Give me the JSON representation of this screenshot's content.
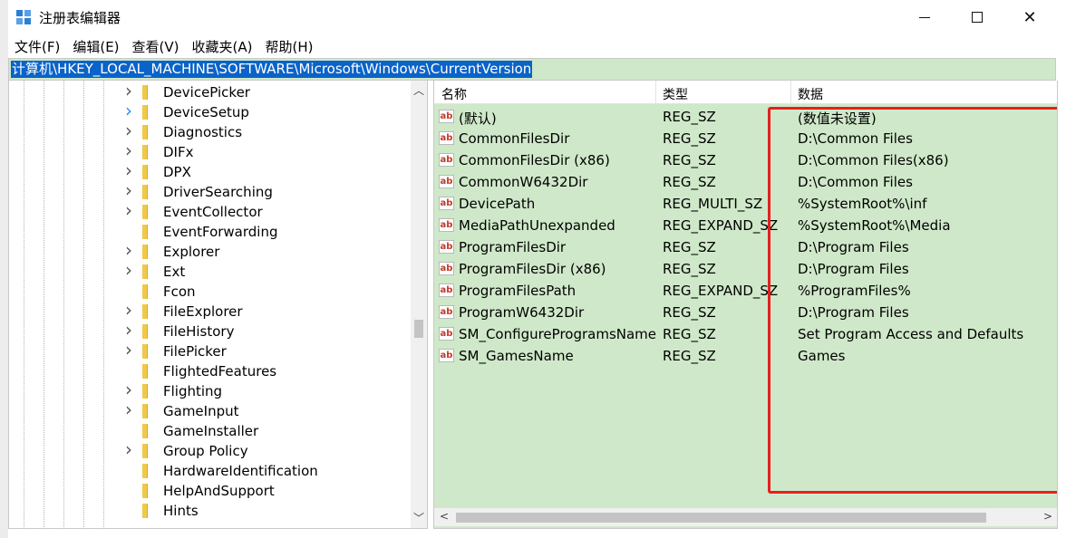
{
  "window": {
    "title": "注册表编辑器",
    "minimize_icon": "minimize-icon",
    "maximize_icon": "maximize-icon",
    "close_glyph": "✕"
  },
  "menu": [
    "文件(F)",
    "编辑(E)",
    "查看(V)",
    "收藏夹(A)",
    "帮助(H)"
  ],
  "address": {
    "path": "计算机\\HKEY_LOCAL_MACHINE\\SOFTWARE\\Microsoft\\Windows\\CurrentVersion"
  },
  "tree": {
    "items": [
      {
        "label": "DevicePicker",
        "expandable": true
      },
      {
        "label": "DeviceSetup",
        "expandable": true,
        "hover": true
      },
      {
        "label": "Diagnostics",
        "expandable": true
      },
      {
        "label": "DIFx",
        "expandable": true
      },
      {
        "label": "DPX",
        "expandable": true
      },
      {
        "label": "DriverSearching",
        "expandable": true
      },
      {
        "label": "EventCollector",
        "expandable": true
      },
      {
        "label": "EventForwarding",
        "expandable": false
      },
      {
        "label": "Explorer",
        "expandable": true
      },
      {
        "label": "Ext",
        "expandable": true
      },
      {
        "label": "Fcon",
        "expandable": false
      },
      {
        "label": "FileExplorer",
        "expandable": true
      },
      {
        "label": "FileHistory",
        "expandable": true
      },
      {
        "label": "FilePicker",
        "expandable": true
      },
      {
        "label": "FlightedFeatures",
        "expandable": false
      },
      {
        "label": "Flighting",
        "expandable": true
      },
      {
        "label": "GameInput",
        "expandable": true
      },
      {
        "label": "GameInstaller",
        "expandable": false
      },
      {
        "label": "Group Policy",
        "expandable": true
      },
      {
        "label": "HardwareIdentification",
        "expandable": false
      },
      {
        "label": "HelpAndSupport",
        "expandable": false
      },
      {
        "label": "Hints",
        "expandable": false
      }
    ]
  },
  "values": {
    "headers": {
      "name": "名称",
      "type": "类型",
      "data": "数据"
    },
    "rows": [
      {
        "name": "(默认)",
        "type": "REG_SZ",
        "data": "(数值未设置)"
      },
      {
        "name": "CommonFilesDir",
        "type": "REG_SZ",
        "data": "D:\\Common Files"
      },
      {
        "name": "CommonFilesDir (x86)",
        "type": "REG_SZ",
        "data": "D:\\Common Files(x86)"
      },
      {
        "name": "CommonW6432Dir",
        "type": "REG_SZ",
        "data": "D:\\Common Files"
      },
      {
        "name": "DevicePath",
        "type": "REG_MULTI_SZ",
        "data": "%SystemRoot%\\inf"
      },
      {
        "name": "MediaPathUnexpanded",
        "type": "REG_EXPAND_SZ",
        "data": "%SystemRoot%\\Media"
      },
      {
        "name": "ProgramFilesDir",
        "type": "REG_SZ",
        "data": "D:\\Program Files"
      },
      {
        "name": "ProgramFilesDir (x86)",
        "type": "REG_SZ",
        "data": "D:\\Program Files"
      },
      {
        "name": "ProgramFilesPath",
        "type": "REG_EXPAND_SZ",
        "data": "%ProgramFiles%"
      },
      {
        "name": "ProgramW6432Dir",
        "type": "REG_SZ",
        "data": "D:\\Program Files"
      },
      {
        "name": "SM_ConfigureProgramsName",
        "type": "REG_SZ",
        "data": "Set Program Access and Defaults"
      },
      {
        "name": "SM_GamesName",
        "type": "REG_SZ",
        "data": "Games"
      }
    ],
    "value_icon_text": "ab"
  },
  "colors": {
    "highlight_green": "#cfe8c9",
    "selection_blue": "#0a63c9",
    "annotation_red": "#e51f1f",
    "folder_yellow": "#f1c94a"
  }
}
